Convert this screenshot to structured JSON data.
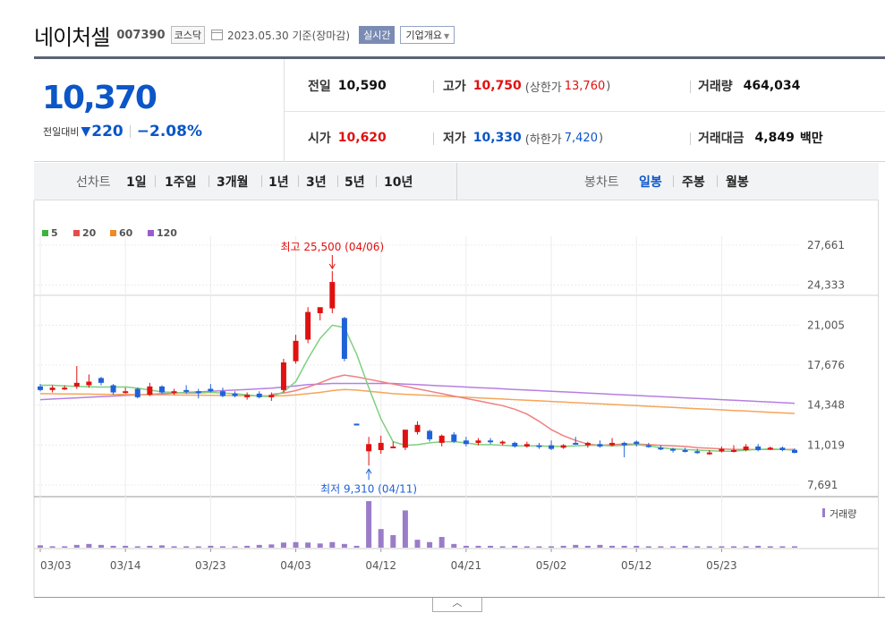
{
  "header": {
    "name": "네이처셀",
    "code": "007390",
    "market": "코스닥",
    "date": "2023.05.30 기준(장마감)",
    "realtime_label": "실시간",
    "overview_label": "기업개요"
  },
  "price": {
    "current": "10,370",
    "change_label": "전일대비",
    "change_arrow": "▼",
    "change_amount": "220",
    "change_percent": "−2.08%",
    "color_down": "#0b56c8",
    "color_up": "#e01111"
  },
  "stats": {
    "prev_label": "전일",
    "prev_value": "10,590",
    "high_label": "고가",
    "high_value": "10,750",
    "upper_label": "(상한가",
    "upper_value": "13,760",
    "upper_close": ")",
    "volume_label": "거래량",
    "volume_value": "464,034",
    "open_label": "시가",
    "open_value": "10,620",
    "low_label": "저가",
    "low_value": "10,330",
    "lower_label": "(하한가",
    "lower_value": "7,420",
    "lower_close": ")",
    "amount_label": "거래대금",
    "amount_value": "4,849",
    "amount_unit": "백만"
  },
  "periods": {
    "line_label": "선차트",
    "line_items": [
      "1일",
      "1주일",
      "3개월",
      "1년",
      "3년",
      "5년",
      "10년"
    ],
    "candle_label": "봉차트",
    "candle_items": [
      "일봉",
      "주봉",
      "월봉"
    ],
    "candle_selected": 0
  },
  "chart_data": {
    "type": "candlestick",
    "legend": [
      {
        "name": "5",
        "color": "#3cb43c"
      },
      {
        "name": "20",
        "color": "#e84b4b"
      },
      {
        "name": "60",
        "color": "#f08a24"
      },
      {
        "name": "120",
        "color": "#9b5bd0"
      }
    ],
    "y_ticks": [
      "27,661",
      "24,333",
      "21,005",
      "17,676",
      "14,348",
      "11,019",
      "7,691"
    ],
    "y_tick_values": [
      27661,
      24333,
      21005,
      17676,
      14348,
      11019,
      7691
    ],
    "ylim": [
      7691,
      27661
    ],
    "x_tick_labels": [
      "03/03",
      "03/14",
      "03/23",
      "04/03",
      "04/12",
      "04/21",
      "05/02",
      "05/12",
      "05/23"
    ],
    "x_tick_indexes": [
      0,
      7,
      14,
      21,
      28,
      35,
      42,
      49,
      56
    ],
    "annotations": [
      {
        "text": "최고 25,500 (04/06)",
        "index": 24,
        "value": 25500,
        "position": "above"
      },
      {
        "text": "최저 9,310 (04/11)",
        "index": 27,
        "value": 9310,
        "position": "below"
      }
    ],
    "volume_label": "거래량",
    "volume_color": "#9b7cc8",
    "up_color": "#e01111",
    "down_color": "#1f62d8",
    "ma5_color": "#7fd07f",
    "ma20_color": "#f08080",
    "ma60_color": "#f5a55a",
    "ma120_color": "#b67fe0",
    "candles": [
      {
        "o": 15900,
        "h": 16100,
        "l": 15500,
        "c": 15600
      },
      {
        "o": 15600,
        "h": 16000,
        "l": 15400,
        "c": 15800
      },
      {
        "o": 15800,
        "h": 16000,
        "l": 15600,
        "c": 15800
      },
      {
        "o": 15900,
        "h": 17600,
        "l": 15700,
        "c": 16200
      },
      {
        "o": 16000,
        "h": 16900,
        "l": 15800,
        "c": 16300
      },
      {
        "o": 16600,
        "h": 16700,
        "l": 16000,
        "c": 16200
      },
      {
        "o": 16000,
        "h": 16100,
        "l": 15200,
        "c": 15400
      },
      {
        "o": 15500,
        "h": 15800,
        "l": 15300,
        "c": 15500
      },
      {
        "o": 15700,
        "h": 15800,
        "l": 14900,
        "c": 15000
      },
      {
        "o": 15200,
        "h": 16200,
        "l": 15100,
        "c": 15900
      },
      {
        "o": 15900,
        "h": 16000,
        "l": 15300,
        "c": 15400
      },
      {
        "o": 15400,
        "h": 15700,
        "l": 15200,
        "c": 15500
      },
      {
        "o": 15600,
        "h": 16000,
        "l": 15300,
        "c": 15500
      },
      {
        "o": 15500,
        "h": 15700,
        "l": 14900,
        "c": 15400
      },
      {
        "o": 15700,
        "h": 16100,
        "l": 15400,
        "c": 15500
      },
      {
        "o": 15500,
        "h": 15800,
        "l": 15000,
        "c": 15100
      },
      {
        "o": 15300,
        "h": 15500,
        "l": 15000,
        "c": 15100
      },
      {
        "o": 15000,
        "h": 15400,
        "l": 14800,
        "c": 15200
      },
      {
        "o": 15300,
        "h": 15500,
        "l": 14900,
        "c": 15000
      },
      {
        "o": 15000,
        "h": 15400,
        "l": 14700,
        "c": 15200
      },
      {
        "o": 15600,
        "h": 18200,
        "l": 15400,
        "c": 17900
      },
      {
        "o": 18000,
        "h": 20200,
        "l": 17800,
        "c": 19700
      },
      {
        "o": 19800,
        "h": 22500,
        "l": 19500,
        "c": 22100
      },
      {
        "o": 22000,
        "h": 22400,
        "l": 21400,
        "c": 22500
      },
      {
        "o": 22400,
        "h": 25500,
        "l": 22000,
        "c": 24600
      },
      {
        "o": 21600,
        "h": 21700,
        "l": 18000,
        "c": 18200
      },
      {
        "o": 12800,
        "h": 12800,
        "l": 12700,
        "c": 12700
      },
      {
        "o": 10500,
        "h": 11700,
        "l": 9310,
        "c": 11100
      },
      {
        "o": 10600,
        "h": 11800,
        "l": 10300,
        "c": 11200
      },
      {
        "o": 10900,
        "h": 11300,
        "l": 10800,
        "c": 10900
      },
      {
        "o": 10800,
        "h": 11700,
        "l": 10600,
        "c": 12300
      },
      {
        "o": 12100,
        "h": 13000,
        "l": 11900,
        "c": 12700
      },
      {
        "o": 12200,
        "h": 12300,
        "l": 11300,
        "c": 11500
      },
      {
        "o": 11200,
        "h": 11900,
        "l": 10900,
        "c": 11800
      },
      {
        "o": 11900,
        "h": 12100,
        "l": 11200,
        "c": 11300
      },
      {
        "o": 11400,
        "h": 11700,
        "l": 10900,
        "c": 11100
      },
      {
        "o": 11200,
        "h": 11600,
        "l": 11000,
        "c": 11400
      },
      {
        "o": 11400,
        "h": 11600,
        "l": 11100,
        "c": 11300
      },
      {
        "o": 11200,
        "h": 11400,
        "l": 11000,
        "c": 11300
      },
      {
        "o": 11200,
        "h": 11300,
        "l": 10800,
        "c": 10900
      },
      {
        "o": 10900,
        "h": 11300,
        "l": 10800,
        "c": 11100
      },
      {
        "o": 11000,
        "h": 11200,
        "l": 10700,
        "c": 10900
      },
      {
        "o": 11000,
        "h": 11400,
        "l": 10600,
        "c": 10700
      },
      {
        "o": 10800,
        "h": 11100,
        "l": 10700,
        "c": 11000
      },
      {
        "o": 11200,
        "h": 11700,
        "l": 11100,
        "c": 11100
      },
      {
        "o": 11000,
        "h": 11300,
        "l": 10800,
        "c": 11200
      },
      {
        "o": 11100,
        "h": 11400,
        "l": 10800,
        "c": 10900
      },
      {
        "o": 11000,
        "h": 11600,
        "l": 10900,
        "c": 11200
      },
      {
        "o": 11200,
        "h": 11300,
        "l": 10000,
        "c": 11000
      },
      {
        "o": 11300,
        "h": 11400,
        "l": 10900,
        "c": 11100
      },
      {
        "o": 11000,
        "h": 11200,
        "l": 10800,
        "c": 10900
      },
      {
        "o": 10800,
        "h": 11000,
        "l": 10600,
        "c": 10700
      },
      {
        "o": 10700,
        "h": 10800,
        "l": 10400,
        "c": 10600
      },
      {
        "o": 10600,
        "h": 10800,
        "l": 10400,
        "c": 10500
      },
      {
        "o": 10500,
        "h": 10700,
        "l": 10300,
        "c": 10400
      },
      {
        "o": 10300,
        "h": 10600,
        "l": 10200,
        "c": 10400
      },
      {
        "o": 10500,
        "h": 10900,
        "l": 10400,
        "c": 10700
      },
      {
        "o": 10500,
        "h": 11000,
        "l": 10400,
        "c": 10600
      },
      {
        "o": 10600,
        "h": 11100,
        "l": 10500,
        "c": 10900
      },
      {
        "o": 10900,
        "h": 11100,
        "l": 10500,
        "c": 10600
      },
      {
        "o": 10700,
        "h": 10900,
        "l": 10600,
        "c": 10800
      },
      {
        "o": 10800,
        "h": 10900,
        "l": 10500,
        "c": 10600
      },
      {
        "o": 10620,
        "h": 10750,
        "l": 10330,
        "c": 10370
      }
    ],
    "volume_relative": [
      0.05,
      0.03,
      0.03,
      0.06,
      0.08,
      0.06,
      0.04,
      0.04,
      0.03,
      0.04,
      0.05,
      0.03,
      0.03,
      0.02,
      0.04,
      0.03,
      0.02,
      0.04,
      0.06,
      0.07,
      0.11,
      0.12,
      0.11,
      0.09,
      0.12,
      0.08,
      0.04,
      1.0,
      0.4,
      0.27,
      0.8,
      0.17,
      0.12,
      0.23,
      0.08,
      0.04,
      0.04,
      0.04,
      0.03,
      0.04,
      0.03,
      0.02,
      0.03,
      0.04,
      0.06,
      0.04,
      0.06,
      0.04,
      0.04,
      0.04,
      0.03,
      0.03,
      0.03,
      0.04,
      0.03,
      0.03,
      0.03,
      0.03,
      0.03,
      0.04,
      0.03,
      0.03,
      0.03
    ],
    "ma5": [
      16000,
      16000,
      15950,
      15900,
      15870,
      15850,
      15850,
      15860,
      15750,
      15600,
      15450,
      15400,
      15350,
      15350,
      15400,
      15350,
      15300,
      15200,
      15100,
      15050,
      15450,
      16300,
      18200,
      19900,
      21000,
      20800,
      18600,
      15800,
      13200,
      11300,
      11000,
      11050,
      11200,
      11300,
      11300,
      11200,
      11050,
      11050,
      11000,
      10950,
      10950,
      10950,
      10900,
      10900,
      10950,
      11000,
      11000,
      10950,
      11000,
      11050,
      10950,
      10800,
      10700,
      10650,
      10600,
      10550,
      10500,
      10500,
      10600,
      10650,
      10700,
      10650,
      10600
    ],
    "ma20": [
      null,
      null,
      null,
      null,
      null,
      null,
      null,
      null,
      null,
      null,
      null,
      null,
      null,
      null,
      null,
      null,
      null,
      null,
      null,
      15250,
      15350,
      15550,
      15850,
      16200,
      16600,
      16850,
      16700,
      16500,
      16300,
      16100,
      15900,
      15700,
      15500,
      15300,
      15100,
      14900,
      14700,
      14500,
      14300,
      14000,
      13600,
      13000,
      12300,
      11800,
      11400,
      11100,
      11000,
      11050,
      11100,
      11100,
      11050,
      11000,
      10950,
      10900,
      10800,
      10750,
      10700,
      10650,
      10650,
      10650,
      10650,
      10650,
      10650
    ],
    "ma60": [
      15300,
      15290,
      15280,
      15270,
      15260,
      15250,
      15240,
      15230,
      15220,
      15210,
      15200,
      15190,
      15180,
      15170,
      15160,
      15150,
      15140,
      15130,
      15120,
      15110,
      15120,
      15200,
      15300,
      15400,
      15550,
      15650,
      15600,
      15500,
      15400,
      15300,
      15250,
      15200,
      15150,
      15100,
      15050,
      15000,
      14950,
      14900,
      14850,
      14800,
      14750,
      14700,
      14650,
      14600,
      14550,
      14500,
      14450,
      14400,
      14350,
      14300,
      14250,
      14200,
      14150,
      14100,
      14050,
      14000,
      13950,
      13900,
      13850,
      13800,
      13750,
      13700,
      13650
    ],
    "ma120": [
      14800,
      14850,
      14900,
      14950,
      15000,
      15050,
      15100,
      15150,
      15200,
      15250,
      15300,
      15350,
      15400,
      15450,
      15500,
      15550,
      15600,
      15650,
      15700,
      15750,
      15850,
      15950,
      16050,
      16100,
      16150,
      16150,
      16150,
      16150,
      16150,
      16150,
      16100,
      16050,
      16000,
      15950,
      15900,
      15850,
      15800,
      15750,
      15700,
      15650,
      15600,
      15550,
      15500,
      15450,
      15400,
      15350,
      15300,
      15250,
      15200,
      15150,
      15100,
      15050,
      15000,
      14950,
      14900,
      14850,
      14800,
      14750,
      14700,
      14650,
      14600,
      14550,
      14500
    ]
  }
}
